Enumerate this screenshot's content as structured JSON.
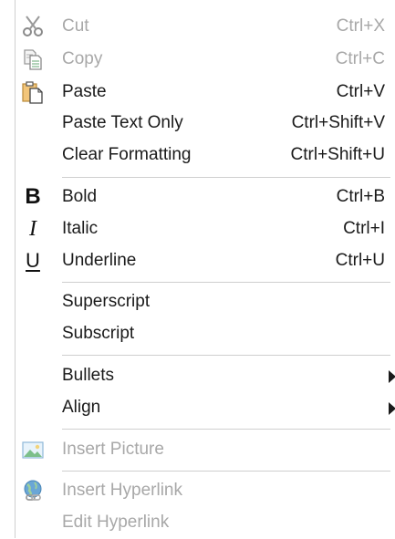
{
  "menu": {
    "cut": {
      "label": "Cut",
      "shortcut": "Ctrl+X",
      "icon": "scissors-icon",
      "enabled": false
    },
    "copy": {
      "label": "Copy",
      "shortcut": "Ctrl+C",
      "icon": "copy-icon",
      "enabled": false
    },
    "paste": {
      "label": "Paste",
      "shortcut": "Ctrl+V",
      "icon": "clipboard-icon",
      "enabled": true
    },
    "paste_text_only": {
      "label": "Paste Text Only",
      "shortcut": "Ctrl+Shift+V",
      "enabled": true
    },
    "clear_formatting": {
      "label": "Clear Formatting",
      "shortcut": "Ctrl+Shift+U",
      "enabled": true
    },
    "bold": {
      "label": "Bold",
      "shortcut": "Ctrl+B",
      "icon_glyph": "B",
      "icon": "bold-icon",
      "enabled": true
    },
    "italic": {
      "label": "Italic",
      "shortcut": "Ctrl+I",
      "icon_glyph": "I",
      "icon": "italic-icon",
      "enabled": true
    },
    "underline": {
      "label": "Underline",
      "shortcut": "Ctrl+U",
      "icon_glyph": "U",
      "icon": "underline-icon",
      "enabled": true
    },
    "superscript": {
      "label": "Superscript",
      "enabled": true
    },
    "subscript": {
      "label": "Subscript",
      "enabled": true
    },
    "bullets": {
      "label": "Bullets",
      "submenu": true,
      "icon": "submenu-arrow-icon",
      "enabled": true
    },
    "align": {
      "label": "Align",
      "submenu": true,
      "icon": "submenu-arrow-icon",
      "enabled": true
    },
    "insert_picture": {
      "label": "Insert Picture",
      "icon": "picture-icon",
      "enabled": false
    },
    "insert_hyperlink": {
      "label": "Insert Hyperlink",
      "icon": "globe-link-icon",
      "enabled": false
    },
    "edit_hyperlink": {
      "label": "Edit Hyperlink",
      "enabled": false
    }
  },
  "colors": {
    "text": "#1a1a1a",
    "disabled_text": "#a8a8a8",
    "separator": "#cfcfcf"
  }
}
